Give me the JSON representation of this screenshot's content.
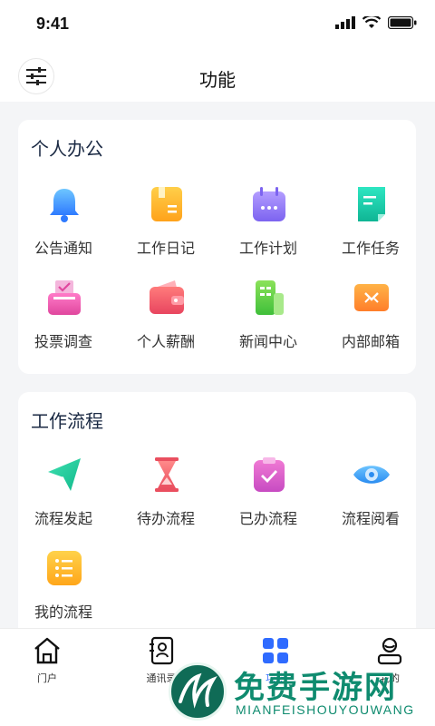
{
  "status": {
    "time": "9:41"
  },
  "header": {
    "title": "功能",
    "menu_icon": "sliders-icon"
  },
  "personal": {
    "title": "个人办公",
    "items": [
      {
        "label": "公告通知",
        "icon": "bell-icon"
      },
      {
        "label": "工作日记",
        "icon": "notebook-icon"
      },
      {
        "label": "工作计划",
        "icon": "calendar-icon"
      },
      {
        "label": "工作任务",
        "icon": "task-doc-icon"
      },
      {
        "label": "投票调查",
        "icon": "ballot-box-icon"
      },
      {
        "label": "个人薪酬",
        "icon": "wallet-icon"
      },
      {
        "label": "新闻中心",
        "icon": "building-icon"
      },
      {
        "label": "内部邮箱",
        "icon": "mail-icon"
      }
    ]
  },
  "workflow": {
    "title": "工作流程",
    "items": [
      {
        "label": "流程发起",
        "icon": "send-icon"
      },
      {
        "label": "待办流程",
        "icon": "hourglass-icon"
      },
      {
        "label": "已办流程",
        "icon": "clipboard-check-icon"
      },
      {
        "label": "流程阅看",
        "icon": "eye-icon"
      },
      {
        "label": "我的流程",
        "icon": "list-icon"
      }
    ]
  },
  "tabs": [
    {
      "label": "门户",
      "icon": "home-icon"
    },
    {
      "label": "通讯录",
      "icon": "contacts-icon"
    },
    {
      "label": "功能",
      "icon": "grid-icon"
    },
    {
      "label": "我的",
      "icon": "user-icon"
    }
  ],
  "watermark": {
    "title": "免费手游网",
    "subtitle": "MIANFEISHOUYOUWANG"
  },
  "colors": {
    "accent": "#2f6bff",
    "title": "#1b2a44",
    "watermark": "#0f8b6f"
  }
}
